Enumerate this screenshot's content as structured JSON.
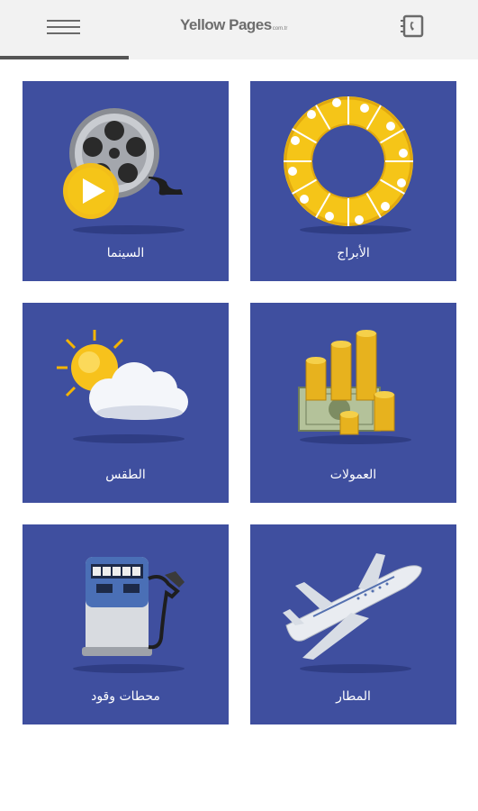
{
  "header": {
    "menu_icon": "hamburger-menu-icon",
    "logo_text": "Yellow Pages",
    "logo_suffix": "com.tr",
    "contact_icon": "phone-book-icon"
  },
  "tiles": [
    {
      "id": "horoscopes",
      "label": "الأبراج",
      "icon": "zodiac-wheel-icon"
    },
    {
      "id": "cinema",
      "label": "السينما",
      "icon": "film-reel-icon"
    },
    {
      "id": "currencies",
      "label": "العمولات",
      "icon": "money-coins-icon"
    },
    {
      "id": "weather",
      "label": "الطقس",
      "icon": "sun-cloud-icon"
    },
    {
      "id": "airport",
      "label": "المطار",
      "icon": "airplane-icon"
    },
    {
      "id": "fuel",
      "label": "محطات وقود",
      "icon": "fuel-pump-icon"
    }
  ],
  "colors": {
    "tile_background": "#3f4f9f",
    "header_background": "#f2f2f2",
    "accent_yellow": "#f5c518"
  }
}
